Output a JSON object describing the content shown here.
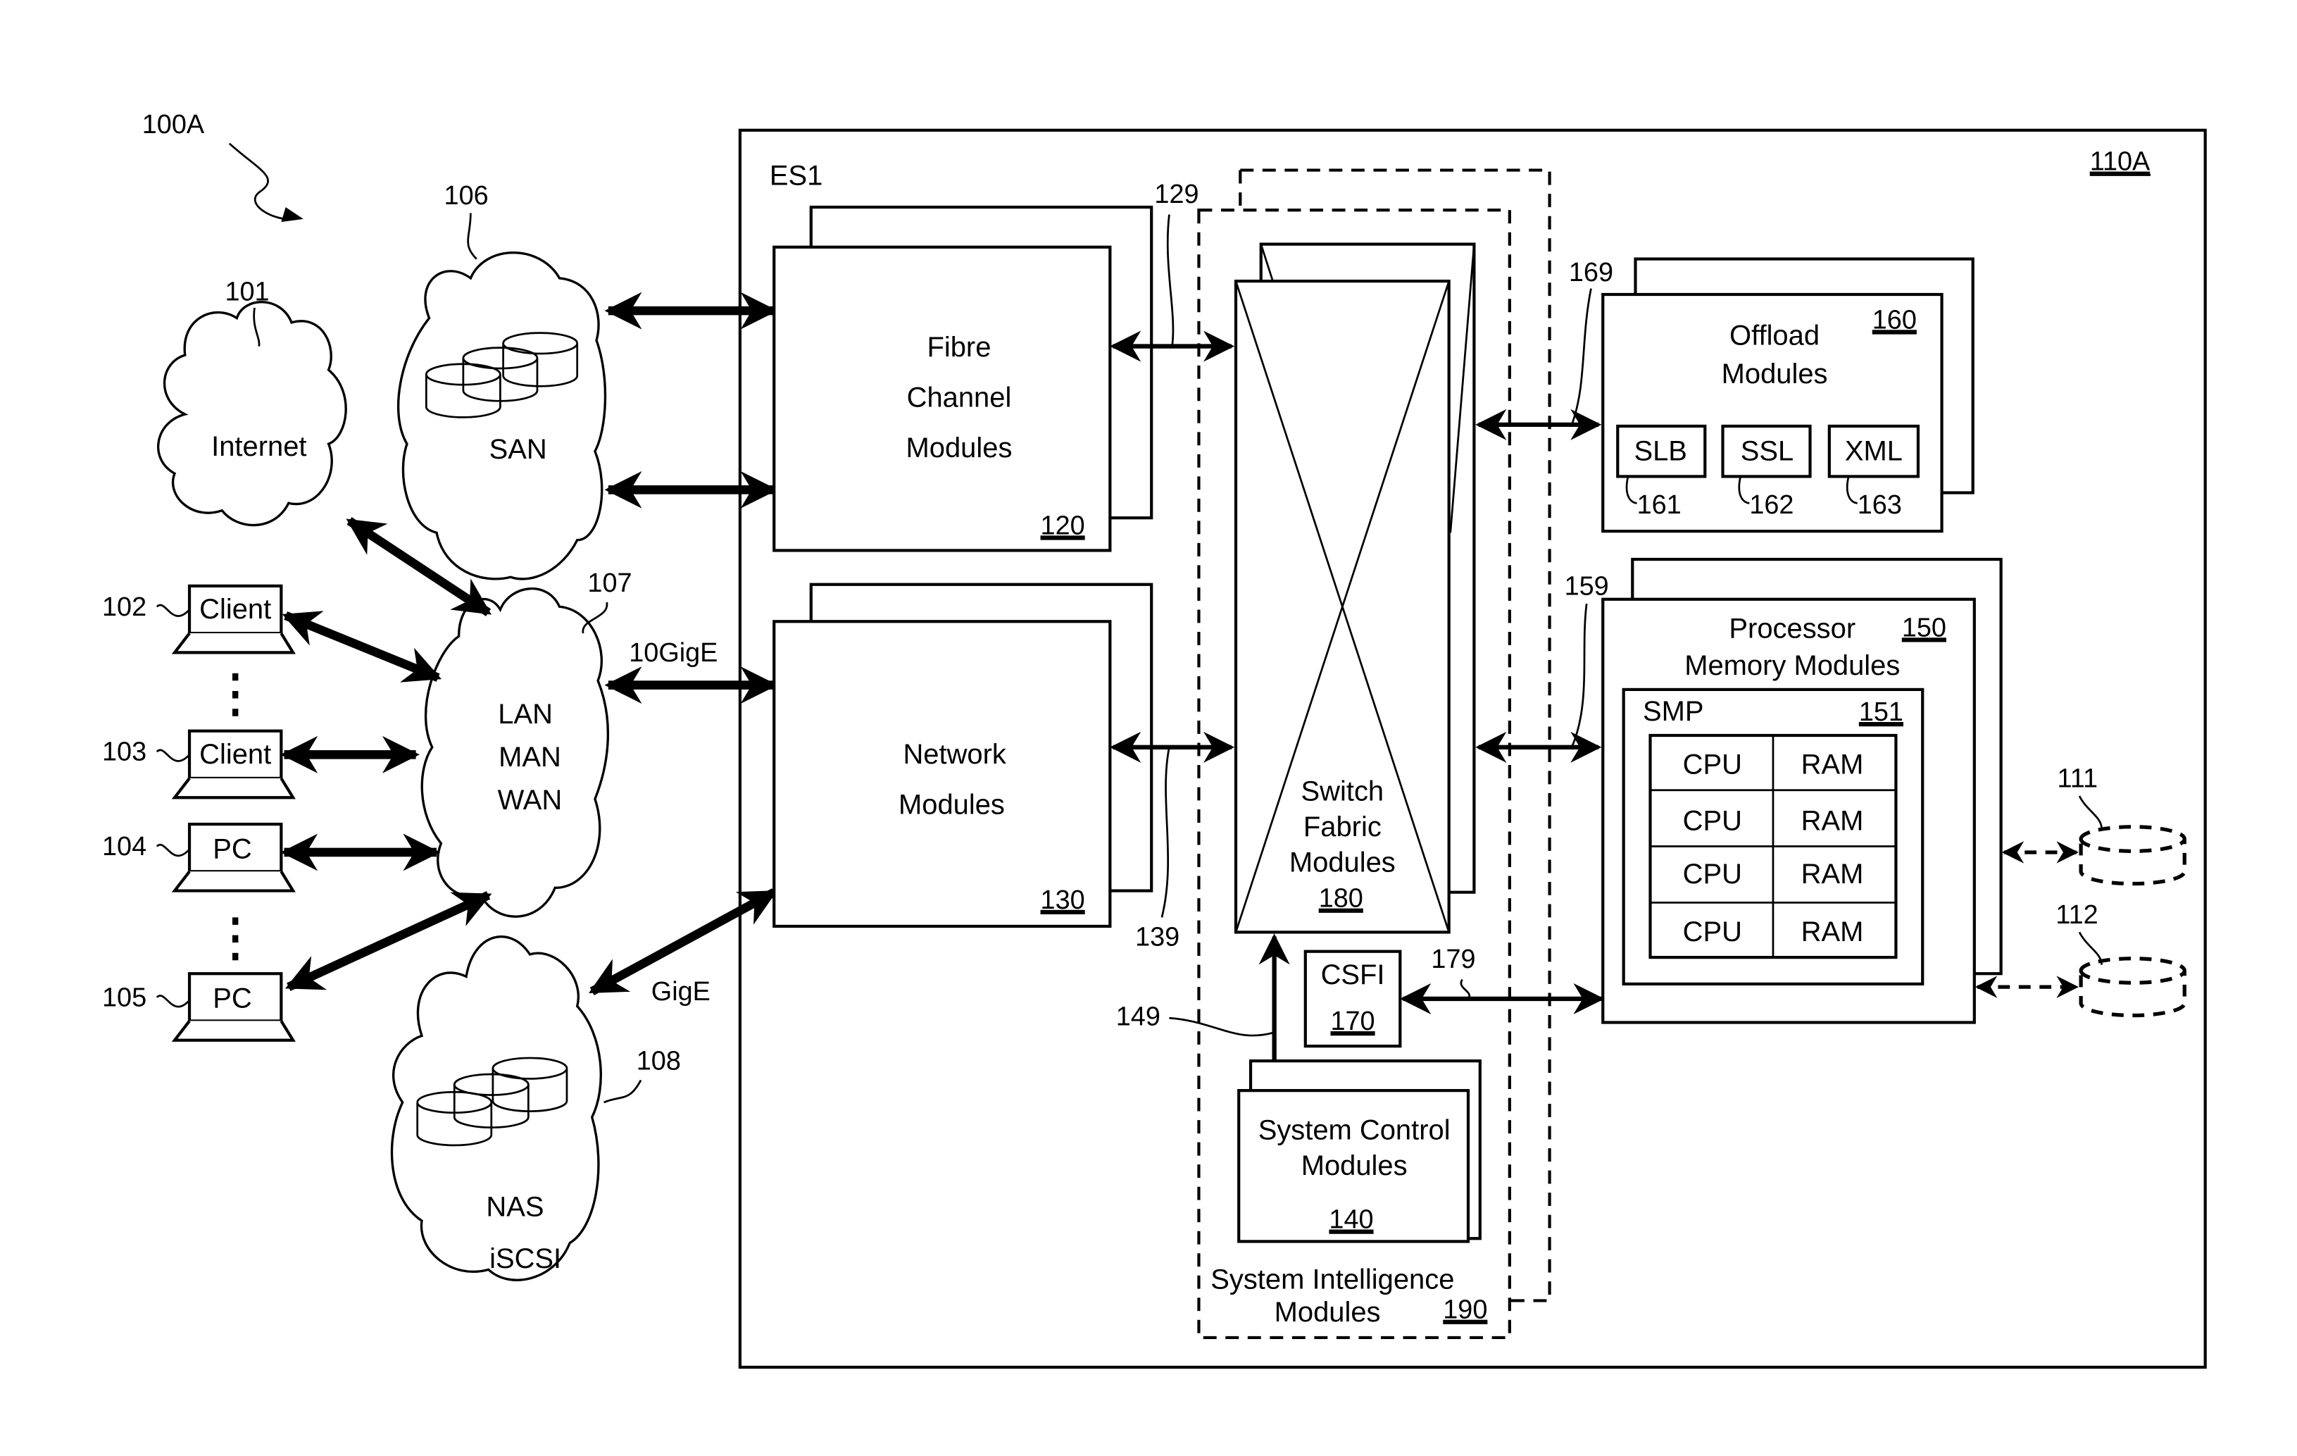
{
  "figure": {
    "id_label": "100A",
    "system_label": "ES1",
    "system_ref": "110A"
  },
  "networks": {
    "internet": {
      "label": "Internet",
      "ref": "101"
    },
    "san": {
      "label": "SAN",
      "ref": "106"
    },
    "lan": {
      "lines": [
        "LAN",
        "MAN",
        "WAN"
      ],
      "ref": "107"
    },
    "nas": {
      "lines": [
        "NAS",
        "iSCSI"
      ],
      "ref": "108"
    }
  },
  "clients": [
    {
      "label": "Client",
      "ref": "102"
    },
    {
      "label": "Client",
      "ref": "103"
    },
    {
      "label": "PC",
      "ref": "104"
    },
    {
      "label": "PC",
      "ref": "105"
    }
  ],
  "links": {
    "tengig": "10GigE",
    "gig": "GigE",
    "fc_ref": "129",
    "net_ref": "139",
    "ctrl_ref": "149",
    "pmm_ref": "159",
    "offload_ref": "169",
    "csfi_ref": "179"
  },
  "modules": {
    "fibre": {
      "lines": [
        "Fibre",
        "Channel",
        "Modules"
      ],
      "ref": "120"
    },
    "network": {
      "lines": [
        "Network",
        "Modules"
      ],
      "ref": "130"
    },
    "switch": {
      "lines": [
        "Switch",
        "Fabric",
        "Modules"
      ],
      "ref": "180"
    },
    "csfi": {
      "label": "CSFI",
      "ref": "170"
    },
    "control": {
      "lines": [
        "System Control",
        "Modules"
      ],
      "ref": "140"
    },
    "intelligence": {
      "lines": [
        "System Intelligence",
        "Modules"
      ],
      "ref": "190"
    },
    "offload": {
      "lines": [
        "Offload",
        "Modules"
      ],
      "ref": "160",
      "subs": [
        {
          "label": "SLB",
          "ref": "161"
        },
        {
          "label": "SSL",
          "ref": "162"
        },
        {
          "label": "XML",
          "ref": "163"
        }
      ]
    },
    "pmm": {
      "lines": [
        "Processor",
        "Memory Modules"
      ],
      "ref": "150",
      "smp": {
        "label": "SMP",
        "ref": "151",
        "rows": [
          [
            "CPU",
            "RAM"
          ],
          [
            "CPU",
            "RAM"
          ],
          [
            "CPU",
            "RAM"
          ],
          [
            "CPU",
            "RAM"
          ]
        ]
      }
    }
  },
  "storage": [
    {
      "ref": "111"
    },
    {
      "ref": "112"
    }
  ]
}
